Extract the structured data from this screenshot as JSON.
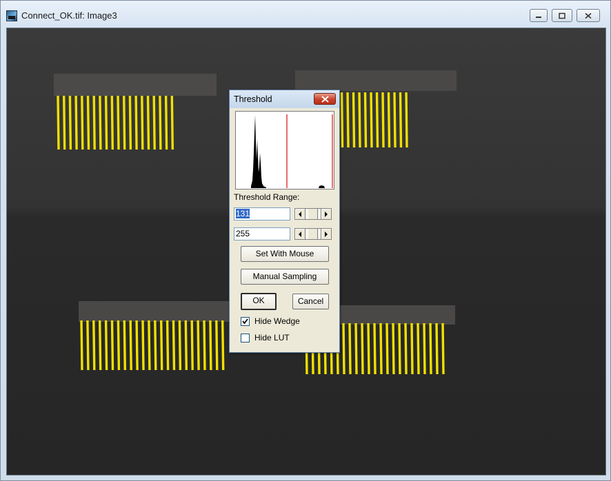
{
  "window": {
    "title": "Connect_OK.tif: Image3",
    "controls": [
      "minimize-icon",
      "maximize-icon",
      "close-icon"
    ]
  },
  "image": {
    "description_colors": {
      "background": "#2b2b2b",
      "highlight": "#f0e000"
    }
  },
  "threshold_dialog": {
    "title": "Threshold",
    "range_label": "Threshold Range:",
    "min_value": "131",
    "max_value": "255",
    "set_with_mouse_label": "Set With Mouse",
    "manual_sampling_label": "Manual Sampling",
    "ok_label": "OK",
    "cancel_label": "Cancel",
    "hide_wedge_label": "Hide Wedge",
    "hide_wedge_checked": true,
    "hide_lut_label": "Hide LUT",
    "hide_lut_checked": false,
    "colors": {
      "threshold_marker": "#e03030"
    }
  }
}
